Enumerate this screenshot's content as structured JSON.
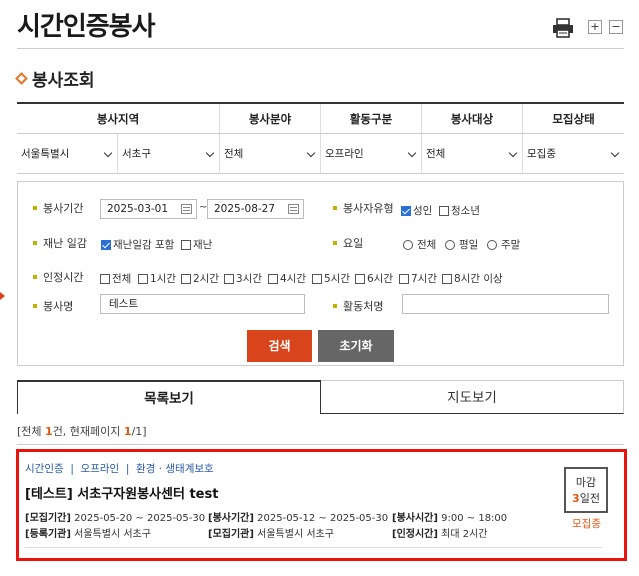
{
  "page": {
    "title": "시간인증봉사"
  },
  "header": {
    "zoom_in": "+",
    "zoom_out": "−"
  },
  "section": {
    "title": "봉사조회"
  },
  "filters": {
    "headers": [
      "봉사지역",
      "봉사분야",
      "활동구분",
      "봉사대상",
      "모집상태"
    ],
    "selects": [
      "서울특별시",
      "서초구",
      "전체",
      "오프라인",
      "전체",
      "모집중"
    ]
  },
  "search": {
    "period_label": "봉사기간",
    "date_from": "2025-03-01",
    "date_sep": "~",
    "date_to": "2025-08-27",
    "type_label": "봉사자유형",
    "type_adult": "성인",
    "type_youth": "청소년",
    "disaster_label": "재난 일감",
    "disaster_include": "재난일감 포함",
    "disaster_only": "재난",
    "day_label": "요일",
    "day_all": "전체",
    "day_weekday": "평일",
    "day_weekend": "주말",
    "hours_label": "인정시간",
    "hours": [
      "전체",
      "1시간",
      "2시간",
      "3시간",
      "4시간",
      "5시간",
      "6시간",
      "7시간",
      "8시간 이상"
    ],
    "name_label": "봉사명",
    "name_value": "테스트",
    "place_label": "활동처명",
    "place_value": "",
    "search_button": "검색",
    "reset_button": "초기화"
  },
  "tabs": {
    "list": "목록보기",
    "map": "지도보기"
  },
  "results": {
    "prefix": "[전체 ",
    "total": "1",
    "mid": "건, 현재페이지 ",
    "page": "1",
    "suffix": "/1]"
  },
  "card": {
    "category": "시간인증  |  오프라인  |  환경 · 생태계보호",
    "title": "[테스트] 서초구자원봉사센터 test",
    "recruit_label": "[모집기간]",
    "recruit_value": "2025-05-20 ~ 2025-05-30",
    "service_label": "[봉사기간]",
    "service_value": "2025-05-12 ~ 2025-05-30",
    "time_label": "[봉사시간]",
    "time_value": "9:00 ~ 18:00",
    "reg_label": "[등록기관]",
    "reg_value": "서울특별시 서초구",
    "org_label": "[모집기관]",
    "org_value": "서울특별시 서초구",
    "cert_label": "[인정시간]",
    "cert_value": "최대 2시간",
    "deadline_title": "마감",
    "deadline_num": "3",
    "deadline_unit": "일전",
    "status": "모집중"
  }
}
